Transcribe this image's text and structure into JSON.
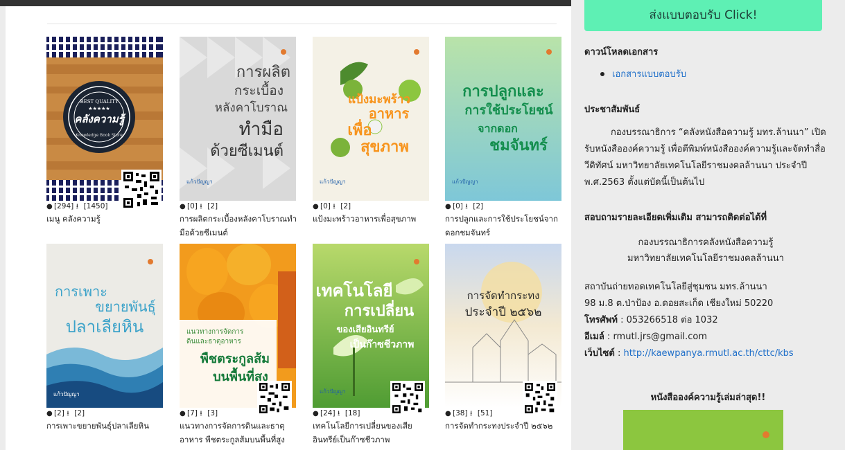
{
  "books": [
    {
      "title": "เมนู คลังความรู้",
      "views": "[294]",
      "downloads": "[1450]",
      "cover_text": [
        "BEST QUALITY",
        "คลังความรู้",
        "Knowledge Book Store"
      ]
    },
    {
      "title": "การผลิตกระเบื้องหลังคาโบราณทำมือด้วยซีเมนต์",
      "views": "[0]",
      "downloads": "[2]",
      "cover_text": [
        "การผลิต",
        "กระเบื้อง",
        "หลังคาโบราณ",
        "ทำมือ",
        "ด้วยซีเมนต์",
        "แก้วปัญญา"
      ]
    },
    {
      "title": "แป้งมะพร้าวอาหารเพื่อสุขภาพ",
      "views": "[0]",
      "downloads": "[2]",
      "cover_text": [
        "แป้งมะพร้าว",
        "อาหาร",
        "เพื่อ",
        "สุขภาพ",
        "แก้วปัญญา"
      ]
    },
    {
      "title": "การปลูกและการใช้ประโยชน์จากดอกชมจันทร์",
      "views": "[0]",
      "downloads": "[2]",
      "cover_text": [
        "การปลูกและ",
        "การใช้ประโยชน์",
        "จากดอก",
        "ชมจันทร์",
        "แก้วปัญญา"
      ]
    },
    {
      "title": "การเพาะขยายพันธุ์ปลาเลียหิน",
      "views": "[2]",
      "downloads": "[2]",
      "cover_text": [
        "การเพาะ",
        "ขยายพันธุ์",
        "ปลาเลียหิน",
        "แก้วปัญญา"
      ]
    },
    {
      "title": "แนวทางการจัดการดินและธาตุอาหาร พืชตระกูลส้มบนพื้นที่สูง",
      "views": "[7]",
      "downloads": "[3]",
      "cover_text": [
        "แนวทางการจัดการ",
        "ดินและธาตุอาหาร",
        "พืชตระกูลส้ม",
        "บนพื้นที่สูง"
      ]
    },
    {
      "title": "เทคโนโลยีการเปลี่ยนของเสียอินทรีย์เป็นก๊าซชีวภาพ",
      "views": "[24]",
      "downloads": "[18]",
      "cover_text": [
        "เทคโนโลยี",
        "การเปลี่ยน",
        "ของเสียอินทรีย์",
        "เป็นก๊าซชีวภาพ",
        "แก้วปัญญา"
      ]
    },
    {
      "title": "การจัดทำกระทงประจำปี ๒๕๖๒",
      "views": "[38]",
      "downloads": "[51]",
      "cover_text": [
        "การจัดทำกระทง",
        "ประจำปี ๒๕๖๒"
      ]
    }
  ],
  "sidebar": {
    "click_button": "ส่งแบบตอบรับ Click!",
    "download_heading": "ดาวน์โหลดเอกสาร",
    "download_link": "เอกสารแบบตอบรับ",
    "pr_heading": "ประชาสัมพันธ์",
    "pr_body": "กองบรรณาธิการ “คลังหนังสือความรู้ มทร.ล้านนา” เปิดรับหนังสือองค์ความรู้ เพื่อตีพิมพ์หนังสือองค์ความรู้และจัดทำสื่อวีดิทัศน์ มหาวิทยาลัยเทคโนโลยีราชมงคลล้านนา ประจำปี พ.ศ.2563 ตั้งแต่บัดนี้เป็นต้นไป",
    "contact_heading": "สอบถามรายละเอียดเพิ่มเติม สามารถติดต่อได้ที่",
    "org_line1": "กองบรรณาธิการคลังหนังสือความรู้",
    "org_line2": "มหาวิทยาลัยเทคโนโลยีราชมงคลล้านนา",
    "address_line1": "สถาบันถ่ายทอดเทคโนโลยีสู่ชุมชน มทร.ล้านนา",
    "address_line2": "98 ม.8 ต.ป่าป้อง อ.ดอยสะเก็ด เชียงใหม่ 50220",
    "phone_label": "โทรศัพท์",
    "phone_value": " : 053266518 ต่อ 1032",
    "email_label": "อีเมล์",
    "email_value": " : rmutl.jrs@gmail.com",
    "website_label": "เว็บไซต์",
    "website_value": "http://kaewpanya.rmutl.ac.th/cttc/kbs",
    "latest_heading": "หนังสือองค์ความรู้เล่มล่าสุด!!"
  },
  "colors": {
    "accent_button": "#5ef0b4",
    "link": "#1f6fc9",
    "sidebar_bg": "#ececec"
  }
}
